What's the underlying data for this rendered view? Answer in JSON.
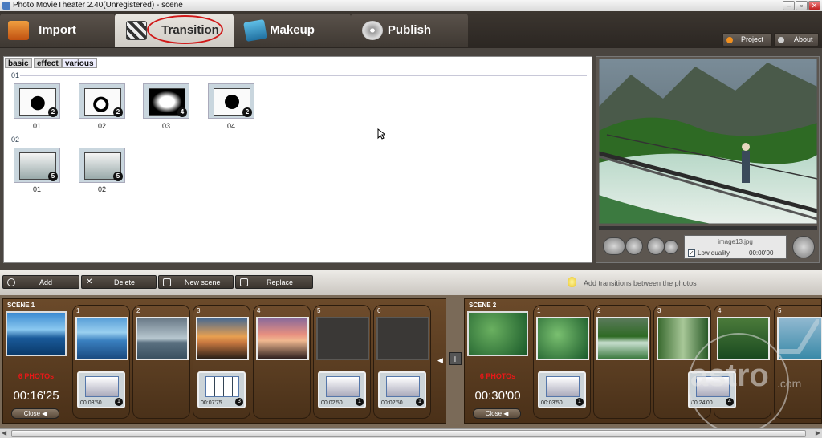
{
  "window": {
    "title": "Photo MovieTheater 2.40(Unregistered) - scene"
  },
  "nav": {
    "tabs": [
      {
        "label": "Import",
        "icon": "import-icon"
      },
      {
        "label": "Transition",
        "icon": "transition-icon"
      },
      {
        "label": "Makeup",
        "icon": "makeup-icon"
      },
      {
        "label": "Publish",
        "icon": "publish-icon"
      }
    ],
    "project_label": "Project",
    "about_label": "About"
  },
  "library": {
    "subtabs": [
      "basic",
      "effect",
      "various"
    ],
    "sections": [
      {
        "label": "01",
        "items": [
          {
            "label": "01",
            "badge": "2"
          },
          {
            "label": "02",
            "badge": "2"
          },
          {
            "label": "03",
            "badge": "4"
          },
          {
            "label": "04",
            "badge": "2"
          }
        ]
      },
      {
        "label": "02",
        "items": [
          {
            "label": "01",
            "badge": "5"
          },
          {
            "label": "02",
            "badge": "5"
          }
        ]
      }
    ]
  },
  "preview": {
    "filename": "image13.jpg",
    "low_quality_label": "Low quality",
    "time": "00:00'00"
  },
  "toolbar": {
    "add": "Add",
    "delete": "Delete",
    "new_scene": "New scene",
    "replace": "Replace",
    "hint": "Add transitions between the photos"
  },
  "scenes": [
    {
      "label": "SCENE 1",
      "count": "6 PHOTOs",
      "time": "00:16'25",
      "close": "Close",
      "slots": [
        {
          "num": "1",
          "dur": "00:03'50",
          "badge": "1"
        },
        {
          "num": "2"
        },
        {
          "num": "3",
          "dur": "00:07'75",
          "badge": "3"
        },
        {
          "num": "4"
        },
        {
          "num": "5",
          "dur": "00:02'50",
          "badge": "1"
        },
        {
          "num": "6",
          "dur": "00:02'50",
          "badge": "1"
        }
      ]
    },
    {
      "label": "SCENE 2",
      "count": "6 PHOTOs",
      "time": "00:30'00",
      "close": "Close",
      "slots": [
        {
          "num": "1",
          "dur": "00:03'50",
          "badge": "1"
        },
        {
          "num": "2"
        },
        {
          "num": "3"
        },
        {
          "num": "4",
          "dur": "00:24'00",
          "badge": "4"
        },
        {
          "num": "5"
        }
      ]
    }
  ],
  "watermark": {
    "text": "astro",
    "sub": ".com"
  },
  "colors": {
    "accent_red": "#d01818",
    "scene_brown": "#6b4a2a"
  }
}
